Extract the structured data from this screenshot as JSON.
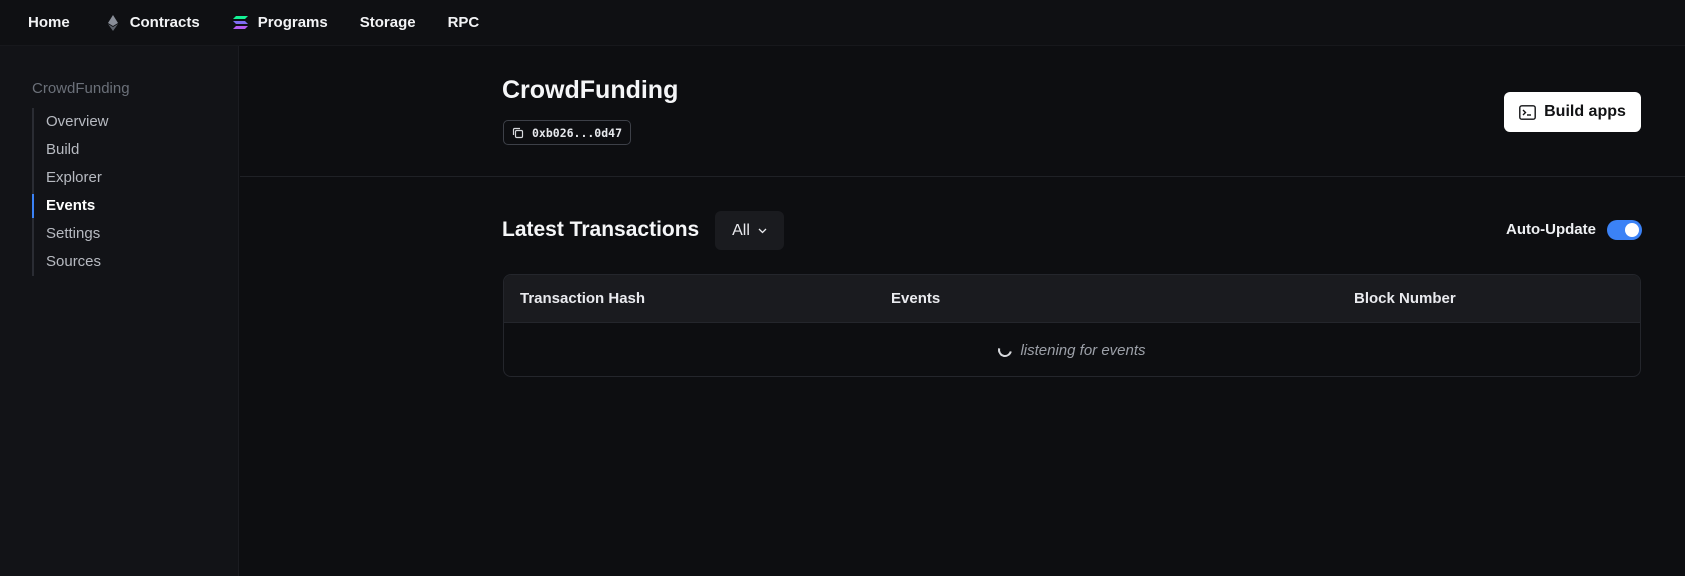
{
  "nav": {
    "items": [
      {
        "label": "Home",
        "icon": null
      },
      {
        "label": "Contracts",
        "icon": "ethereum-icon"
      },
      {
        "label": "Programs",
        "icon": "solana-icon"
      },
      {
        "label": "Storage",
        "icon": null
      },
      {
        "label": "RPC",
        "icon": null
      }
    ]
  },
  "sidebar": {
    "title": "CrowdFunding",
    "items": [
      {
        "label": "Overview",
        "active": false
      },
      {
        "label": "Build",
        "active": false
      },
      {
        "label": "Explorer",
        "active": false
      },
      {
        "label": "Events",
        "active": true
      },
      {
        "label": "Settings",
        "active": false
      },
      {
        "label": "Sources",
        "active": false
      }
    ]
  },
  "header": {
    "title": "CrowdFunding",
    "address": "0xb026...0d47",
    "address_icon": "copy-icon",
    "build_button": {
      "label": "Build apps",
      "icon": "terminal-icon"
    }
  },
  "transactions": {
    "title": "Latest Transactions",
    "filter": {
      "selected": "All",
      "icon": "chevron-down-icon"
    },
    "auto_update": {
      "label": "Auto-Update",
      "enabled": true
    },
    "columns": [
      "Transaction Hash",
      "Events",
      "Block Number"
    ],
    "empty_state": "listening for events"
  },
  "colors": {
    "background": "#0d0e11",
    "sidebar": "#121317",
    "accent": "#3b82f6"
  }
}
